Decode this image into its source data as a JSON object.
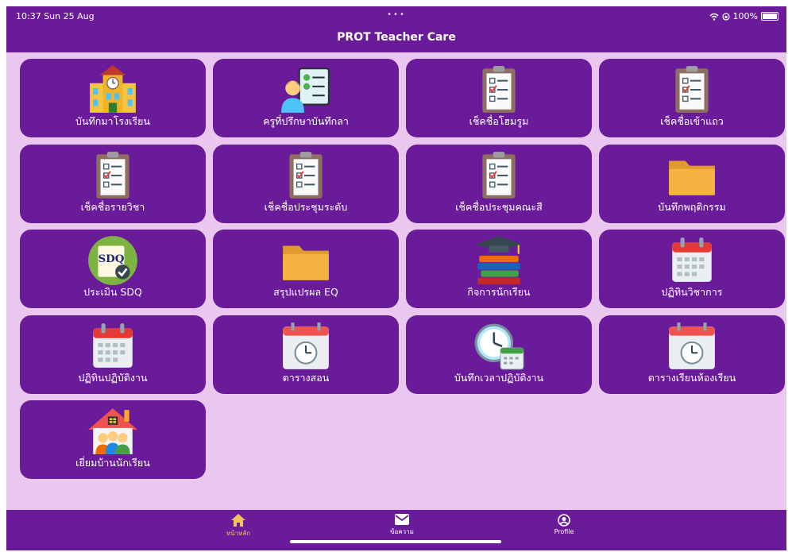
{
  "status_bar": {
    "time": "10:37  Sun 25 Aug",
    "dots": "•••",
    "battery": "100%"
  },
  "header": {
    "title": "PROT Teacher Care"
  },
  "tiles": [
    {
      "label": "บันทึกมาโรงเรียน",
      "icon": "school-building-icon"
    },
    {
      "label": "ครูที่ปรึกษาบันทึกลา",
      "icon": "teacher-checklist-icon"
    },
    {
      "label": "เช็คชื่อโฮมรูม",
      "icon": "clipboard-icon"
    },
    {
      "label": "เช็คชื่อเข้าแถว",
      "icon": "clipboard-icon"
    },
    {
      "label": "เช็คชื่อรายวิชา",
      "icon": "clipboard-icon"
    },
    {
      "label": "เช็คชื่อประชุมระดับ",
      "icon": "clipboard-icon"
    },
    {
      "label": "เช็คชื่อประชุมคณะสี",
      "icon": "clipboard-icon"
    },
    {
      "label": "บันทึกพฤติกรรม",
      "icon": "folder-icon"
    },
    {
      "label": "ประเมิน SDQ",
      "icon": "sdq-icon"
    },
    {
      "label": "สรุปแปรผล EQ",
      "icon": "folder-icon"
    },
    {
      "label": "กิจการนักเรียน",
      "icon": "graduation-books-icon"
    },
    {
      "label": "ปฏิทินวิชาการ",
      "icon": "calendar-icon"
    },
    {
      "label": "ปฏิทินปฏิบัติงาน",
      "icon": "calendar-icon"
    },
    {
      "label": "ตารางสอน",
      "icon": "calendar-clock-icon"
    },
    {
      "label": "บันทึกเวลาปฏิบัติงาน",
      "icon": "clock-calendar-icon"
    },
    {
      "label": "ตารางเรียนห้องเรียน",
      "icon": "calendar-clock-icon"
    },
    {
      "label": "เยี่ยมบ้านนักเรียน",
      "icon": "home-visit-icon"
    }
  ],
  "tabs": [
    {
      "label": "หน้าหลัก",
      "icon": "home-icon",
      "active": true
    },
    {
      "label": "ข้อความ",
      "icon": "mail-icon",
      "active": false
    },
    {
      "label": "Profile",
      "icon": "profile-icon",
      "active": false
    }
  ],
  "colors": {
    "primary": "#6a1b9a",
    "background": "#e9c7ef",
    "active_tab": "#f3c25c"
  }
}
